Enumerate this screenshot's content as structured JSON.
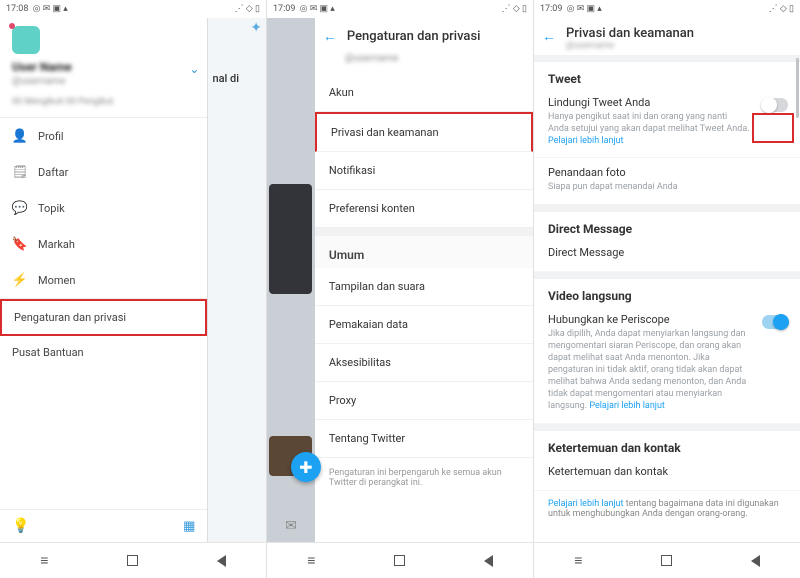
{
  "status": {
    "time1": "17:08",
    "time2": "17:09",
    "time3": "17:09",
    "iconsL": "◎ ✉ ▣ ▴",
    "iconsR": "⋰ ◇ ▯"
  },
  "drawer": {
    "user_name": "User Name",
    "user_handle": "@username",
    "stats": "00 Mengikuti   00 Pengikut",
    "items": [
      {
        "icon": "👤",
        "label": "Profil"
      },
      {
        "icon": "🗒",
        "label": "Daftar"
      },
      {
        "icon": "💬",
        "label": "Topik"
      },
      {
        "icon": "🔖",
        "label": "Markah"
      },
      {
        "icon": "⚡",
        "label": "Momen"
      }
    ],
    "settings_label": "Pengaturan dan privasi",
    "help_label": "Pusat Bantuan"
  },
  "p1_right_text": "nal di",
  "pane2": {
    "title": "Pengaturan dan privasi",
    "handle": "@username",
    "rows": [
      "Akun",
      "Privasi dan keamanan",
      "Notifikasi",
      "Preferensi konten"
    ],
    "section": "Umum",
    "rows2": [
      "Tampilan dan suara",
      "Pemakaian data",
      "Aksesibilitas",
      "Proxy",
      "Tentang Twitter"
    ],
    "footer": "Pengaturan ini berpengaruh ke semua akun Twitter di perangkat ini."
  },
  "pane3": {
    "title": "Privasi dan keamanan",
    "handle": "@username",
    "sec_tweet": "Tweet",
    "protect_label": "Lindungi Tweet Anda",
    "protect_desc": "Hanya pengikut saat ini dan orang yang nanti Anda setujui yang akan dapat melihat Tweet Anda. ",
    "learn_more": "Pelajari lebih lanjut",
    "photo_label": "Penandaan foto",
    "photo_desc": "Siapa pun dapat menandai Anda",
    "sec_dm": "Direct Message",
    "dm_label": "Direct Message",
    "sec_video": "Video langsung",
    "periscope_label": "Hubungkan ke Periscope",
    "periscope_desc": "Jika dipilih, Anda dapat menyiarkan langsung dan mengomentari siaran Periscope, dan orang akan dapat melihat saat Anda menonton. Jika pengaturan ini tidak aktif, orang tidak akan dapat melihat bahwa Anda sedang menonton, dan Anda tidak dapat mengomentari atau menyiarkan langsung. ",
    "sec_discover": "Ketertemuan dan kontak",
    "discover_label": "Ketertemuan dan kontak",
    "discover_footer": " tentang bagaimana data ini digunakan untuk menghubungkan Anda dengan orang-orang."
  }
}
